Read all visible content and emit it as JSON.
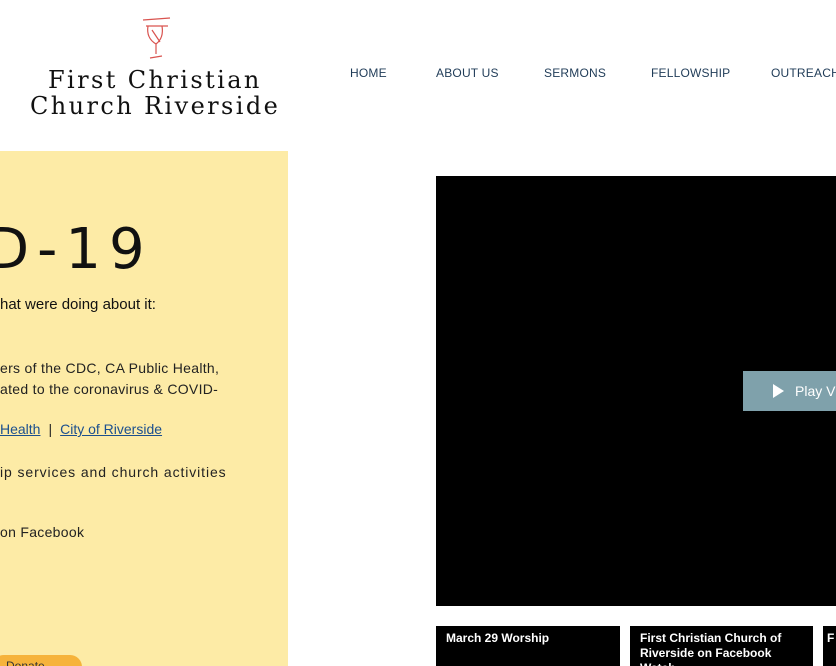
{
  "header": {
    "logo_line1": "First Christian",
    "logo_line2": "Church Riverside",
    "logo_icon": "communion-cup-icon",
    "logo_icon_color": "#d9534f"
  },
  "nav": {
    "items": [
      {
        "label": "HOME"
      },
      {
        "label": "ABOUT US"
      },
      {
        "label": "SERMONS"
      },
      {
        "label": "FELLOWSHIP"
      },
      {
        "label": "OUTREACH"
      }
    ]
  },
  "panel": {
    "background": "#fdeba6",
    "headline": "D-19",
    "subhead": "hat were doing about it:",
    "para1_line1": "ers of the CDC, CA Public Health,",
    "para1_line2": "ated to the coronavirus & COVID-",
    "link1": "Health",
    "separator": "|",
    "link2": "City of Riverside",
    "para2": "ip services and church activities",
    "para3": "on Facebook",
    "donate_label": "Donate"
  },
  "video": {
    "play_label": "Play Vi",
    "play_icon": "play-icon",
    "button_color": "#7fa1ab"
  },
  "playlist": {
    "items": [
      {
        "title": "March 29 Worship"
      },
      {
        "title": "First Christian Church of Riverside on Facebook Watch"
      },
      {
        "title": "F"
      }
    ]
  }
}
